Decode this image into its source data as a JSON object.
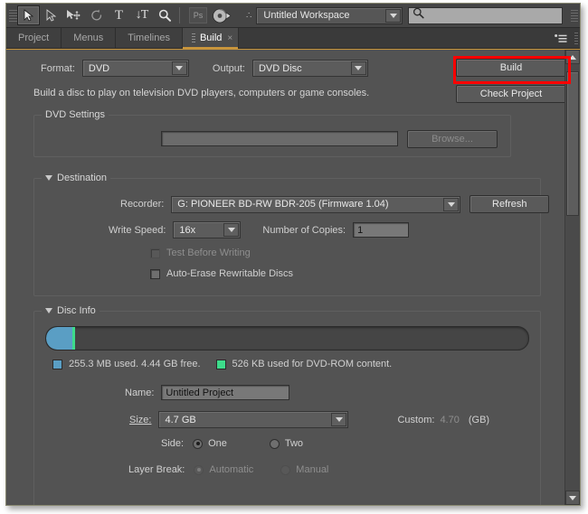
{
  "toolbar": {
    "tools": [
      {
        "name": "selection-tool",
        "glyph": "arrow",
        "active": true
      },
      {
        "name": "direct-selection-tool",
        "glyph": "arrow-outline",
        "active": false
      },
      {
        "name": "move-tool",
        "glyph": "move",
        "active": false
      },
      {
        "name": "rotate-tool",
        "glyph": "rotate",
        "active": false
      },
      {
        "name": "text-tool",
        "label": "T",
        "active": false
      },
      {
        "name": "vertical-text-tool",
        "label": "↓T",
        "active": false
      },
      {
        "name": "zoom-tool",
        "glyph": "magnifier",
        "active": false
      }
    ],
    "photoshop_button_label": "Ps",
    "encore_button_name": "disc-icon",
    "workspace_icon_label": "∴",
    "workspace_value": "Untitled Workspace",
    "search_value": "",
    "search_placeholder": ""
  },
  "tabs": [
    {
      "label": "Project",
      "active": false,
      "closable": false
    },
    {
      "label": "Menus",
      "active": false,
      "closable": false
    },
    {
      "label": "Timelines",
      "active": false,
      "closable": false
    },
    {
      "label": "Build",
      "active": true,
      "closable": true,
      "close_glyph": "×"
    }
  ],
  "panel_menu_glyph": "≡",
  "build": {
    "format_label": "Format:",
    "format_value": "DVD",
    "output_label": "Output:",
    "output_value": "DVD Disc",
    "build_button_label": "Build",
    "check_project_button_label": "Check Project",
    "description": "Build a disc to play on television DVD players, computers or game consoles.",
    "dvd_settings_title": "DVD Settings",
    "path_value": "",
    "browse_button_label": "Browse...",
    "browse_disabled": true
  },
  "destination": {
    "title": "Destination",
    "recorder_label": "Recorder:",
    "recorder_value": "G: PIONEER BD-RW   BDR-205 (Firmware 1.04)",
    "refresh_button_label": "Refresh",
    "write_speed_label": "Write Speed:",
    "write_speed_value": "16x",
    "copies_label": "Number of Copies:",
    "copies_value": "1",
    "test_before_writing_label": "Test Before Writing",
    "test_before_writing_checked": false,
    "test_before_writing_disabled": true,
    "auto_erase_label": "Auto-Erase Rewritable Discs",
    "auto_erase_checked": false
  },
  "disc_info": {
    "title": "Disc Info",
    "used_percent": 5.4,
    "rom_percent": 0.6,
    "used_swatch_color": "#5a9ec4",
    "rom_swatch_color": "#3ddc8b",
    "used_text": "255.3 MB used.  4.44 GB free.",
    "rom_text": "526 KB used for DVD-ROM content.",
    "name_label": "Name:",
    "name_value": "Untitled Project",
    "size_label": "Size:",
    "size_value": "4.7 GB",
    "custom_label": "Custom:",
    "custom_value": "4.70",
    "custom_unit": "(GB)",
    "custom_disabled": true,
    "side_label": "Side:",
    "side_one_label": "One",
    "side_two_label": "Two",
    "side_selected": "One",
    "layer_break_label": "Layer Break:",
    "layer_automatic_label": "Automatic",
    "layer_manual_label": "Manual",
    "layer_selected": "Automatic",
    "layer_disabled": true
  },
  "accent_color": "#c8953c",
  "annotation_color": "#ff0000"
}
